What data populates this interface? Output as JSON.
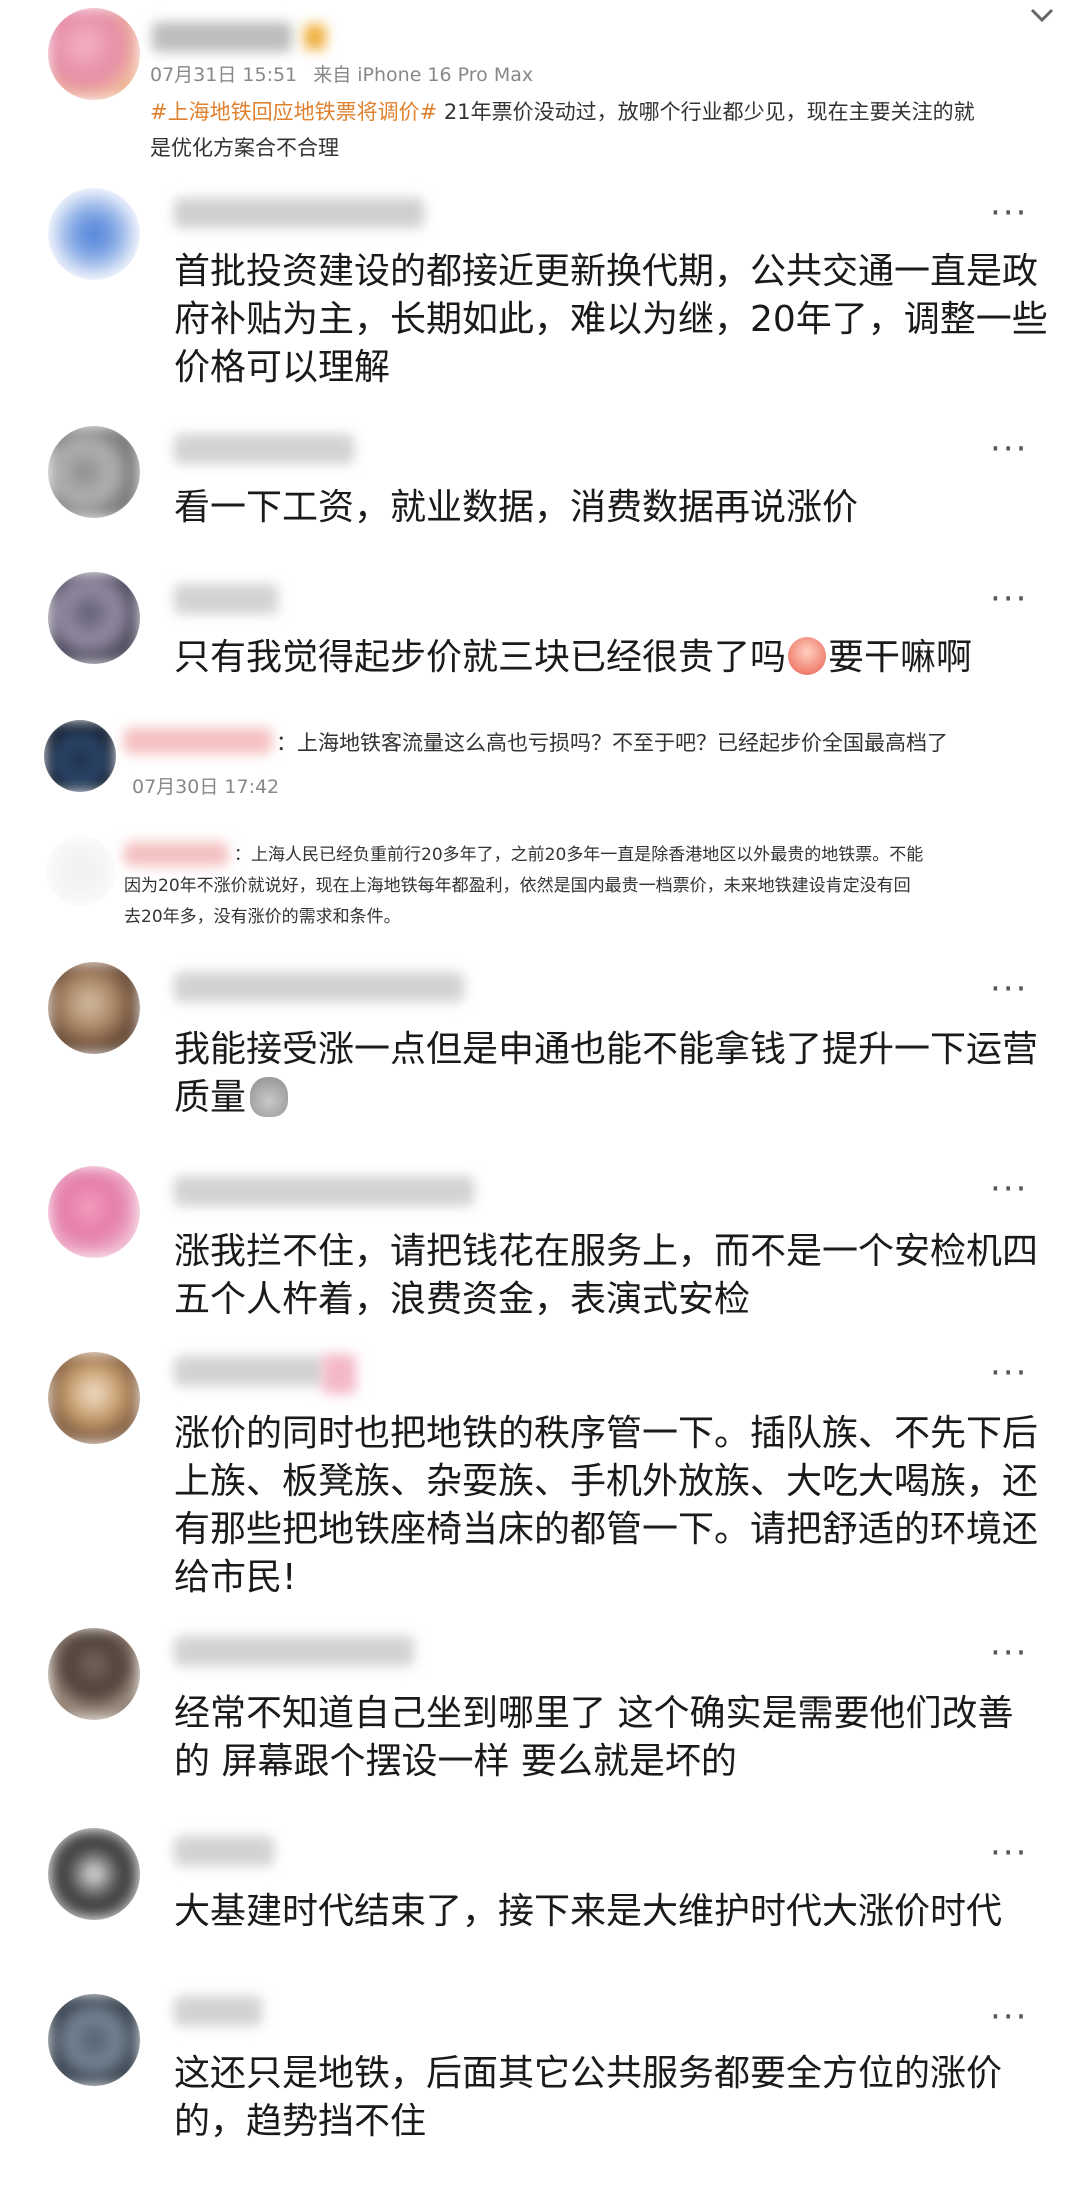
{
  "top_post": {
    "time": "07月31日 15:51",
    "source": "来自 iPhone 16 Pro Max",
    "hashtag": "#上海地铁回应地铁票将调价#",
    "text1": " 21年票价没动过，放哪个行业都少见，现在主要关注的就",
    "text2": "是优化方案合不合理"
  },
  "comments": [
    {
      "line1": "首批投资建设的都接近更新换代期，公共交通一直是政",
      "line2": "府补贴为主，长期如此，难以为继，20年了，调整一些",
      "line3": "价格可以理解"
    },
    {
      "line1": "看一下工资，就业数据，消费数据再说涨价"
    },
    {
      "line1_before": "只有我觉得起步价就三块已经很贵了吗",
      "emoji": "crying-face",
      "line1_after": "要干嘛啊"
    }
  ],
  "reply1": {
    "text": "：上海地铁客流量这么高也亏损吗？不至于吧？已经起步价全国最高档了",
    "time": "07月30日 17:42"
  },
  "reply2": {
    "line1": "：上海人民已经负重前行20多年了，之前20多年一直是除香港地区以外最贵的地铁票。不能",
    "line2": "因为20年不涨价就说好，现在上海地铁每年都盈利，依然是国内最贵一档票价，未来地铁建设肯定没有回",
    "line3": "去20年多，没有涨价的需求和条件。"
  },
  "comments2": [
    {
      "line1": "我能接受涨一点但是申通也能不能拿钱了提升一下运营",
      "line2": "质量",
      "emoji": "money-bag"
    },
    {
      "line1": "涨我拦不住，请把钱花在服务上，而不是一个安检机四",
      "line2": "五个人杵着，浪费资金，表演式安检"
    },
    {
      "line1": "涨价的同时也把地铁的秩序管一下。插队族、不先下后",
      "line2": "上族、板凳族、杂耍族、手机外放族、大吃大喝族，还",
      "line3": "有那些把地铁座椅当床的都管一下。请把舒适的环境还",
      "line4": "给市民!"
    },
    {
      "line1": "经常不知道自己坐到哪里了 这个确实是需要他们改善",
      "line2": "的 屏幕跟个摆设一样 要么就是坏的"
    },
    {
      "line1": "大基建时代结束了，接下来是大维护时代大涨价时代"
    },
    {
      "line1": "这还只是地铁，后面其它公共服务都要全方位的涨价",
      "line2": "的，趋势挡不住"
    }
  ],
  "more_label": "···",
  "chevron": "chevron-down-icon"
}
